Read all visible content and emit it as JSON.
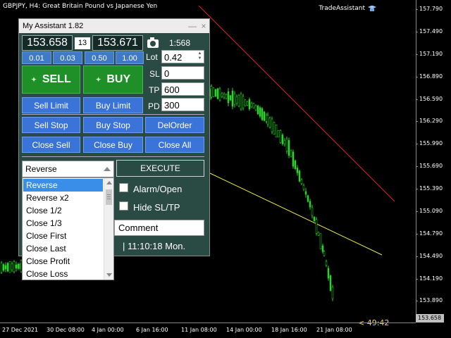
{
  "chart": {
    "title": "GBPJPY, H4:  Great Britain Pound vs Japanese Yen",
    "trade_assistant": "TradeAssistant",
    "y_ticks": [
      "157.790",
      "157.490",
      "157.190",
      "156.890",
      "156.590",
      "156.290",
      "155.990",
      "155.690",
      "155.390",
      "155.090",
      "154.790",
      "154.490",
      "154.190",
      "153.890"
    ],
    "x_ticks": [
      "27 Dec 2021",
      "30 Dec 08:00",
      "4 Jan 00:00",
      "6 Jan 16:00",
      "11 Jan 08:00",
      "14 Jan 00:00",
      "18 Jan 16:00",
      "21 Jan 08:00"
    ],
    "current_price": "153.658",
    "countdown": "< 49:42",
    "colors": {
      "candle": "#2bd42b",
      "red_line": "#e02020",
      "yellow_line": "#e8e840"
    }
  },
  "panel": {
    "title": "My Assistant 1.82",
    "minimize": "—",
    "close": "×",
    "bid": "153.658",
    "spread": "13",
    "ask": "153.671",
    "ratio": "1:568",
    "lot_presets": [
      "0.01",
      "0.03",
      "0.50",
      "1.00"
    ],
    "lot_label": "Lot",
    "lot_value": "0.42",
    "sl_label": "SL",
    "sl_value": "0",
    "tp_label": "TP",
    "tp_value": "600",
    "pd_label": "PD",
    "pd_value": "300",
    "sell_label": "SELL",
    "buy_label": "BUY",
    "sell_limit": "Sell Limit",
    "buy_limit": "Buy Limit",
    "sell_stop": "Sell Stop",
    "buy_stop": "Buy Stop",
    "del_order": "DelOrder",
    "close_sell": "Close Sell",
    "close_buy": "Close Buy",
    "close_all": "Close All",
    "execute": "EXECUTE",
    "alarm_label": "Alarm/Open",
    "hide_label": "Hide SL/TP",
    "comment": "Comment",
    "clock": "| 11:10:18  Mon.",
    "colors": {
      "panel_bg": "#2a4a44",
      "sell_buy": "#1f8f27",
      "blue_button": "#3b74d9"
    }
  },
  "dropdown": {
    "selected": "Reverse",
    "options": [
      "Reverse",
      "Reverse x2",
      "Close 1/2",
      "Close 1/3",
      "Close First",
      "Close Last",
      "Close Profit",
      "Close Loss"
    ]
  }
}
